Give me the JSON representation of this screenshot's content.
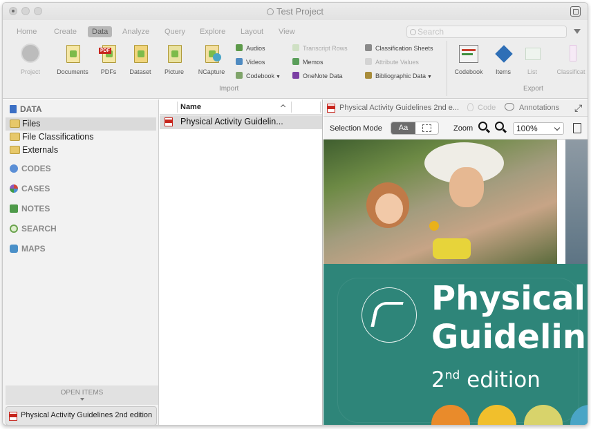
{
  "window": {
    "title": "Test Project"
  },
  "ribbon": {
    "tabs": [
      "Home",
      "Create",
      "Data",
      "Analyze",
      "Query",
      "Explore",
      "Layout",
      "View"
    ],
    "active_tab": "Data",
    "search_placeholder": "Search",
    "big_buttons": [
      {
        "label": "Project",
        "icon": "project-icon",
        "enabled": false
      },
      {
        "label": "Documents",
        "icon": "documents-icon",
        "enabled": true
      },
      {
        "label": "PDFs",
        "icon": "pdf-icon",
        "enabled": true
      },
      {
        "label": "Dataset",
        "icon": "dataset-icon",
        "enabled": true
      },
      {
        "label": "Picture",
        "icon": "picture-icon",
        "enabled": true
      },
      {
        "label": "NCapture",
        "icon": "ncapture-icon",
        "enabled": true
      }
    ],
    "import_col1": [
      {
        "label": "Audios",
        "icon": "audio-icon",
        "enabled": true
      },
      {
        "label": "Videos",
        "icon": "video-icon",
        "enabled": true
      },
      {
        "label": "Codebook",
        "icon": "codebook-small-icon",
        "enabled": true,
        "dropdown": true
      }
    ],
    "import_col2": [
      {
        "label": "Transcript Rows",
        "icon": "transcript-icon",
        "enabled": false
      },
      {
        "label": "Memos",
        "icon": "memos-icon",
        "enabled": true
      },
      {
        "label": "OneNote Data",
        "icon": "onenote-icon",
        "enabled": true
      }
    ],
    "import_col3": [
      {
        "label": "Classification Sheets",
        "icon": "classification-sheets-icon",
        "enabled": true
      },
      {
        "label": "Attribute Values",
        "icon": "attribute-values-icon",
        "enabled": false
      },
      {
        "label": "Bibliographic Data",
        "icon": "bibliographic-icon",
        "enabled": true,
        "dropdown": true
      }
    ],
    "import_label": "Import",
    "export_buttons": [
      {
        "label": "Codebook",
        "icon": "codebook-export-icon",
        "enabled": true
      },
      {
        "label": "Items",
        "icon": "items-icon",
        "enabled": true
      },
      {
        "label": "List",
        "icon": "list-icon",
        "enabled": false
      },
      {
        "label": "Classificat",
        "icon": "classification-icon",
        "enabled": false
      }
    ],
    "export_label": "Export"
  },
  "nav": {
    "sections": [
      {
        "label": "DATA",
        "color": "#3b6fc4"
      },
      {
        "label": "CODES",
        "color": "#5b8fd6"
      },
      {
        "label": "CASES",
        "color": "#8a5bc0"
      },
      {
        "label": "NOTES",
        "color": "#4e9a4a"
      },
      {
        "label": "SEARCH",
        "color": "#6aa34e"
      },
      {
        "label": "MAPS",
        "color": "#4a90c8"
      }
    ],
    "data_items": [
      "Files",
      "File Classifications",
      "Externals"
    ],
    "selected_item": "Files",
    "open_items_label": "OPEN ITEMS",
    "open_document": "Physical Activity Guidelines 2nd edition"
  },
  "list": {
    "column_name": "Name",
    "rows": [
      "Physical Activity Guidelin..."
    ]
  },
  "viewer": {
    "doc_title": "Physical Activity Guidelines 2nd e...",
    "code_label": "Code",
    "annotations_label": "Annotations",
    "selection_mode_label": "Selection Mode",
    "text_mode_label": "Aa",
    "zoom_label": "Zoom",
    "zoom_value": "100%",
    "cover": {
      "title_line1": "Physical",
      "title_line2": "Guideline",
      "edition_number": "2",
      "edition_suffix": "nd",
      "edition_word": "edition",
      "circle_colors": [
        "#e98b2b",
        "#f1bf2c",
        "#d8d36b",
        "#4aa5c6"
      ]
    }
  }
}
